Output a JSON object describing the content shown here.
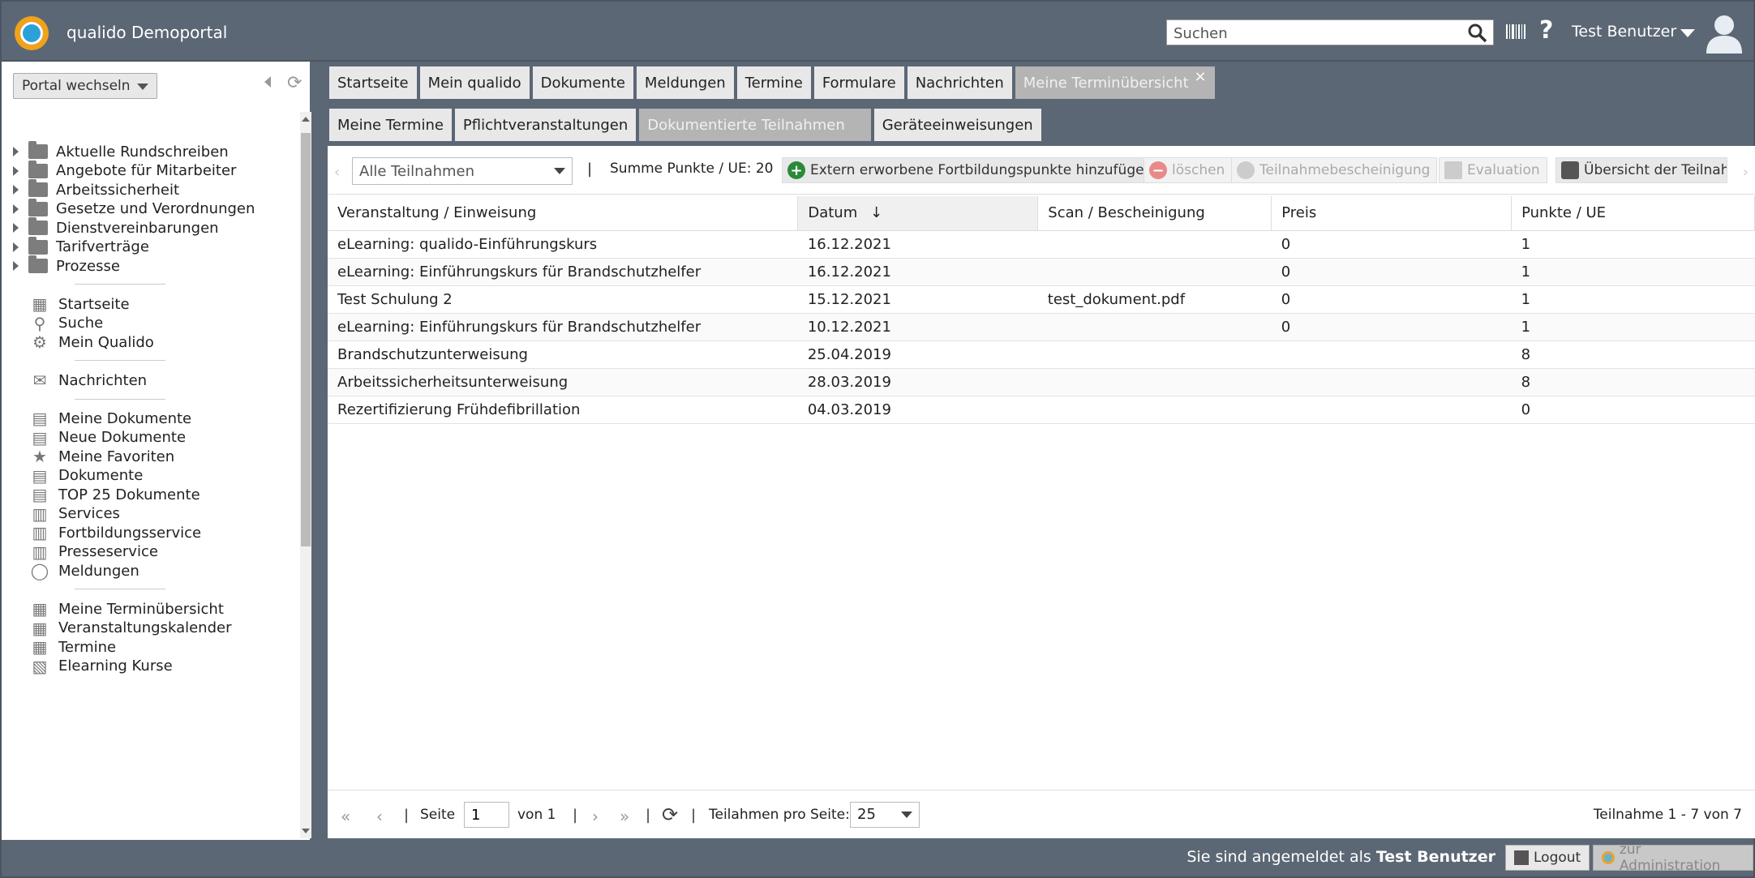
{
  "header": {
    "app_title": "qualido Demoportal",
    "search_placeholder": "Suchen",
    "help_label": "?",
    "user_name": "Test Benutzer"
  },
  "sidebar": {
    "portal_switch": "Portal wechseln",
    "tree": [
      "Aktuelle Rundschreiben",
      "Angebote für Mitarbeiter",
      "Arbeitssicherheit",
      "Gesetze und Verordnungen",
      "Dienstvereinbarungen",
      "Tarifverträge",
      "Prozesse"
    ],
    "nav_group1": [
      {
        "label": "Startseite",
        "icon": "grid-icon"
      },
      {
        "label": "Suche",
        "icon": "search-icon"
      },
      {
        "label": "Mein Qualido",
        "icon": "modules-icon"
      }
    ],
    "nav_group2": [
      {
        "label": "Nachrichten",
        "icon": "envelope-icon"
      }
    ],
    "nav_group3": [
      {
        "label": "Meine Dokumente",
        "icon": "document-icon"
      },
      {
        "label": "Neue Dokumente",
        "icon": "document-icon"
      },
      {
        "label": "Meine Favoriten",
        "icon": "star-icon"
      },
      {
        "label": "Dokumente",
        "icon": "document-icon"
      },
      {
        "label": "TOP 25 Dokumente",
        "icon": "document-icon"
      },
      {
        "label": "Services",
        "icon": "book-icon"
      },
      {
        "label": "Fortbildungsservice",
        "icon": "book-icon"
      },
      {
        "label": "Presseservice",
        "icon": "book-icon"
      },
      {
        "label": "Meldungen",
        "icon": "speech-bubble-icon"
      }
    ],
    "nav_group4": [
      {
        "label": "Meine Terminübersicht",
        "icon": "calendar-icon"
      },
      {
        "label": "Veranstaltungskalender",
        "icon": "calendar-icon"
      },
      {
        "label": "Termine",
        "icon": "calendar-icon"
      },
      {
        "label": "Elearning Kurse",
        "icon": "elearning-icon"
      }
    ]
  },
  "tabs_main": [
    {
      "label": "Startseite",
      "active": false
    },
    {
      "label": "Mein qualido",
      "active": false
    },
    {
      "label": "Dokumente",
      "active": false
    },
    {
      "label": "Meldungen",
      "active": false
    },
    {
      "label": "Termine",
      "active": false
    },
    {
      "label": "Formulare",
      "active": false
    },
    {
      "label": "Nachrichten",
      "active": false
    },
    {
      "label": "Meine Terminübersicht",
      "active": true,
      "close": "×"
    }
  ],
  "tabs_sub": [
    {
      "label": "Meine Termine",
      "active": false
    },
    {
      "label": "Pflichtveranstaltungen",
      "active": false
    },
    {
      "label": "Dokumentierte Teilnahmen",
      "active": true
    },
    {
      "label": "Geräteeinweisungen",
      "active": false
    }
  ],
  "toolbar": {
    "filter_value": "Alle Teilnahmen",
    "separator": "|",
    "sum_label": "Summe Punkte / UE: 20",
    "add_external": "Extern erworbene Fortbildungspunkte hinzufügen",
    "delete": "löschen",
    "certificate": "Teilnahmebescheinigung",
    "evaluation": "Evaluation",
    "overview": "Übersicht der Teilnahmen",
    "colors": {
      "add": "#2a8a3a",
      "delete": "#e05a5a"
    }
  },
  "table": {
    "columns": [
      "Veranstaltung / Einweisung",
      "Datum",
      "Scan / Bescheinigung",
      "Preis",
      "Punkte / UE"
    ],
    "sorted_column": "Datum",
    "rows": [
      [
        "eLearning: qualido-Einführungskurs",
        "16.12.2021",
        "",
        "0",
        "1"
      ],
      [
        "eLearning: Einführungskurs für Brandschutzhelfer",
        "16.12.2021",
        "",
        "0",
        "1"
      ],
      [
        "Test Schulung 2",
        "15.12.2021",
        "test_dokument.pdf",
        "0",
        "1"
      ],
      [
        "eLearning: Einführungskurs für Brandschutzhelfer",
        "10.12.2021",
        "",
        "0",
        "1"
      ],
      [
        "Brandschutzunterweisung",
        "25.04.2019",
        "",
        "",
        "8"
      ],
      [
        "Arbeitssicherheitsunterweisung",
        "28.03.2019",
        "",
        "",
        "8"
      ],
      [
        "Rezertifizierung Frühdefibrillation",
        "04.03.2019",
        "",
        "",
        "0"
      ]
    ]
  },
  "pager": {
    "page_label": "Seite",
    "page_value": "1",
    "of_label": "von 1",
    "per_page_label": "Teilahmen pro Seite:",
    "per_page_value": "25",
    "range": "Teilnahme 1 - 7 von 7"
  },
  "footer": {
    "logged_in_prefix": "Sie sind angemeldet als",
    "logged_in_user": "Test Benutzer",
    "logout": "Logout",
    "admin": "zur Administration"
  }
}
